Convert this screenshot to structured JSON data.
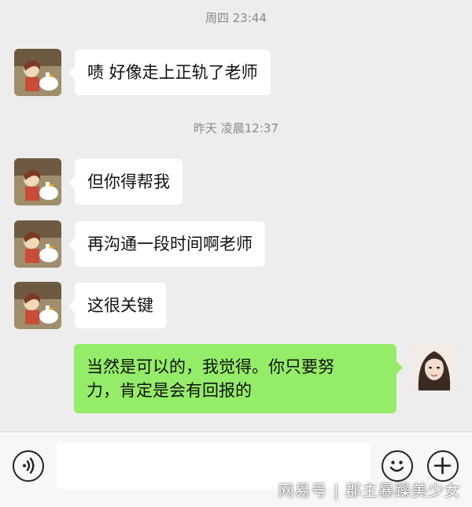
{
  "messages": [
    {
      "timestamp": "周四 23:44"
    },
    {
      "from": "other",
      "text": "啧 好像走上正轨了老师"
    },
    {
      "timestamp": "昨天 凌晨12:37"
    },
    {
      "from": "other",
      "text": "但你得帮我"
    },
    {
      "from": "other",
      "text": "再沟通一段时间啊老师"
    },
    {
      "from": "other",
      "text": "这很关键"
    },
    {
      "from": "self",
      "text": "当然是可以的，我觉得。你只要努\n力，肯定是会有回报的"
    }
  ],
  "input": {
    "placeholder": ""
  },
  "icons": {
    "voice": "voice-icon",
    "emoji": "emoji-icon",
    "plus": "plus-icon"
  },
  "watermark": "网易号 | 郡主暴躁美少女",
  "colors": {
    "background": "#ededed",
    "bubble_other": "#ffffff",
    "bubble_self": "#95ec69"
  }
}
